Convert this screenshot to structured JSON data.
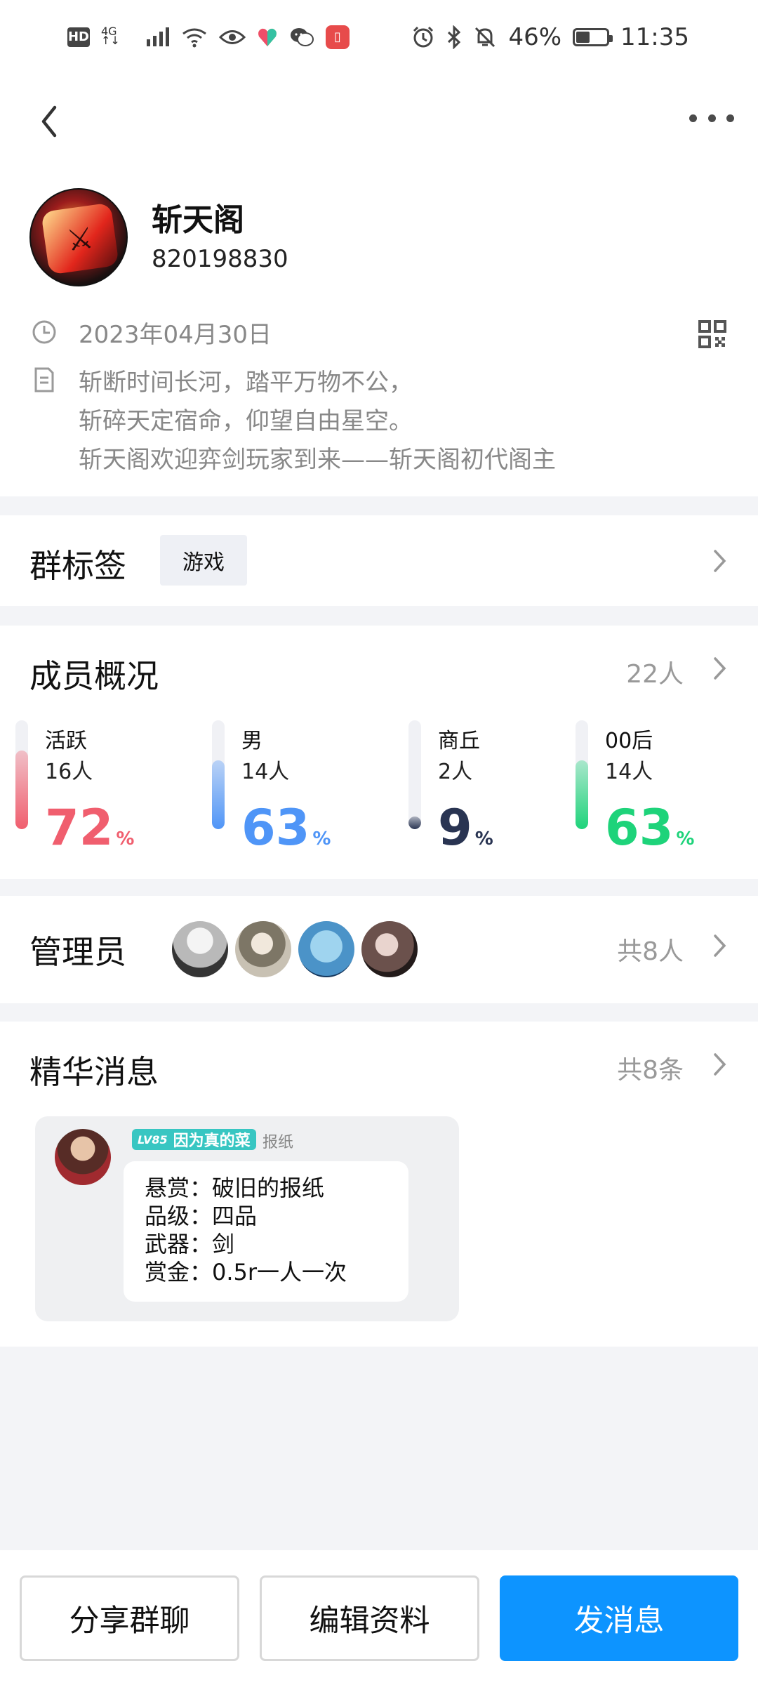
{
  "status_bar": {
    "hd": "HD",
    "network": "4G",
    "battery_percent": "46%",
    "battery_level": 0.46,
    "time": "11:35"
  },
  "group": {
    "name": "斩天阁",
    "id": "820198830",
    "date": "2023年04月30日",
    "description_lines": [
      "斩断时间长河，踏平万物不公，",
      "斩碎天定宿命，仰望自由星空。",
      "斩天阁欢迎弈剑玩家到来——斩天阁初代阁主"
    ]
  },
  "tags": {
    "title": "群标签",
    "tag": "游戏"
  },
  "members": {
    "title": "成员概况",
    "total": "22人",
    "stats": [
      {
        "label": "活跃",
        "count": "16人",
        "percent": 72,
        "pct_symbol": "%",
        "color": "#f05e6e"
      },
      {
        "label": "男",
        "count": "14人",
        "percent": 63,
        "pct_symbol": "%",
        "color": "#4f95f7"
      },
      {
        "label": "商丘",
        "count": "2人",
        "percent": 9,
        "pct_symbol": "%",
        "color": "#293452"
      },
      {
        "label": "00后",
        "count": "14人",
        "percent": 63,
        "pct_symbol": "%",
        "color": "#1ed37a"
      }
    ]
  },
  "admins": {
    "title": "管理员",
    "count": "共8人"
  },
  "essence": {
    "title": "精华消息",
    "count": "共8条",
    "level": "LV85",
    "nickname": "因为真的菜",
    "sender_name": "报纸",
    "lines": [
      "悬赏：破旧的报纸",
      "品级：四品",
      "武器：剑",
      "赏金：0.5r一人一次"
    ]
  },
  "actions": {
    "share": "分享群聊",
    "edit": "编辑资料",
    "message": "发消息"
  }
}
